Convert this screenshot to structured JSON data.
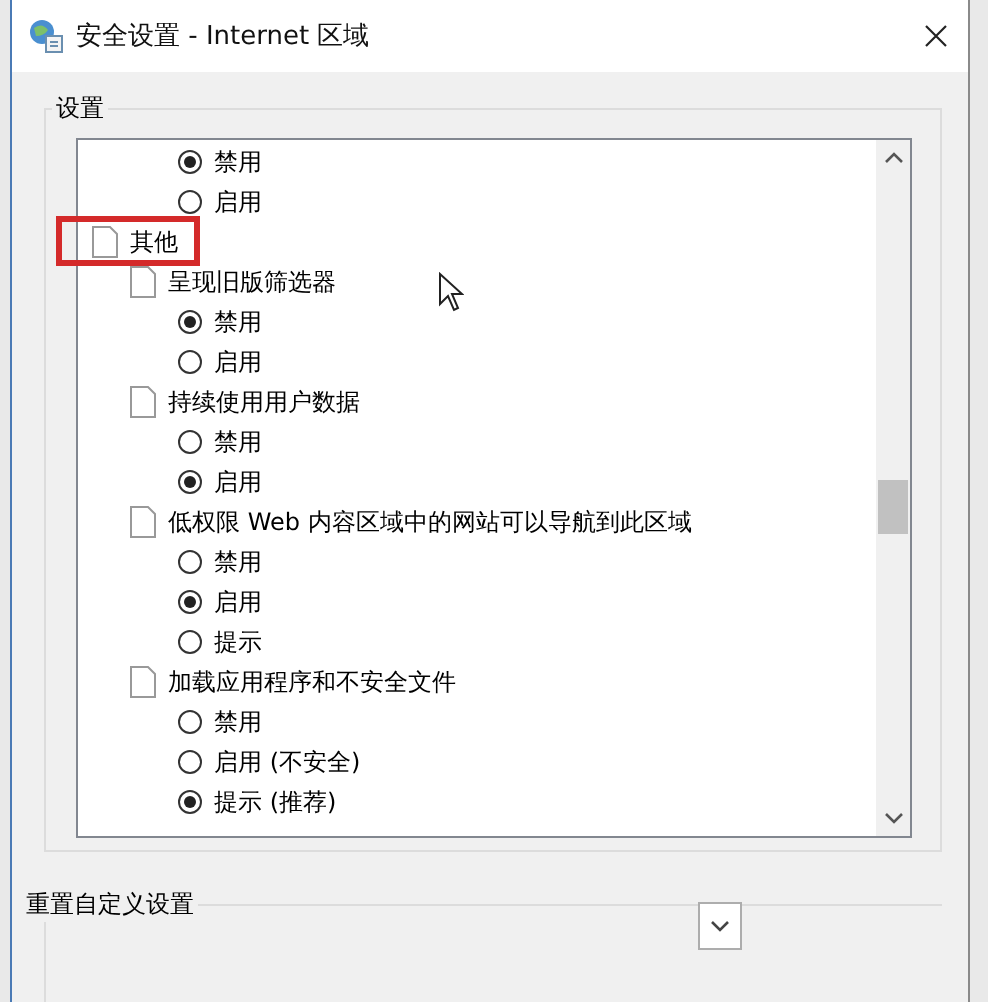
{
  "window": {
    "title": "安全设置 - Internet 区域"
  },
  "settings_group": {
    "title": "设置"
  },
  "tree": [
    {
      "kind": "option",
      "label": "禁用",
      "selected": true
    },
    {
      "kind": "option",
      "label": "启用",
      "selected": false
    },
    {
      "kind": "category",
      "label": "其他",
      "highlighted": true,
      "children": [
        {
          "kind": "setting",
          "label": "呈现旧版筛选器",
          "children": [
            {
              "kind": "option",
              "label": "禁用",
              "selected": true
            },
            {
              "kind": "option",
              "label": "启用",
              "selected": false
            }
          ]
        },
        {
          "kind": "setting",
          "label": "持续使用用户数据",
          "children": [
            {
              "kind": "option",
              "label": "禁用",
              "selected": false
            },
            {
              "kind": "option",
              "label": "启用",
              "selected": true
            }
          ]
        },
        {
          "kind": "setting",
          "label": "低权限 Web 内容区域中的网站可以导航到此区域",
          "children": [
            {
              "kind": "option",
              "label": "禁用",
              "selected": false
            },
            {
              "kind": "option",
              "label": "启用",
              "selected": true
            },
            {
              "kind": "option",
              "label": "提示",
              "selected": false
            }
          ]
        },
        {
          "kind": "setting",
          "label": "加载应用程序和不安全文件",
          "children": [
            {
              "kind": "option",
              "label": "禁用",
              "selected": false
            },
            {
              "kind": "option",
              "label": "启用 (不安全)",
              "selected": false
            },
            {
              "kind": "option",
              "label": "提示 (推荐)",
              "selected": true
            }
          ]
        }
      ]
    }
  ],
  "reset_group": {
    "title": "重置自定义设置"
  }
}
